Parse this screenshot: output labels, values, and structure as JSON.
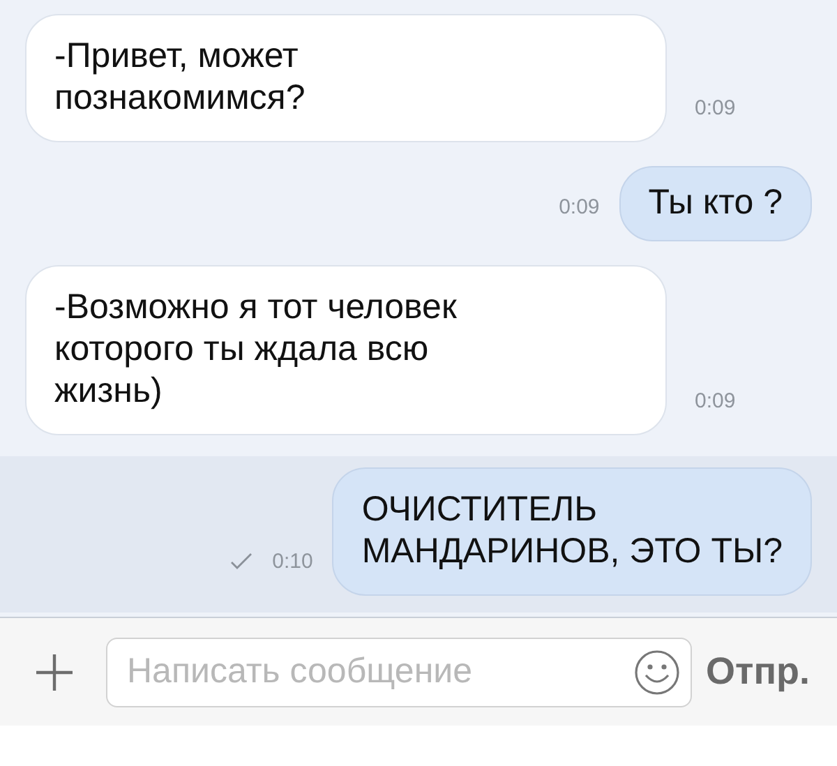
{
  "messages": [
    {
      "kind": "incoming",
      "text": "-Привет, может\nпознакомимся?",
      "time": "0:09",
      "selected": false
    },
    {
      "kind": "outgoing",
      "text": "Ты кто ?",
      "time": "0:09",
      "read": false,
      "selected": false
    },
    {
      "kind": "incoming",
      "text": "-Возможно я тот человек\nкоторого ты ждала всю\nжизнь)",
      "time": "0:09",
      "selected": false
    },
    {
      "kind": "outgoing",
      "text": "ОЧИСТИТЕЛЬ\nМАНДАРИНОВ, ЭТО ТЫ?",
      "time": "0:10",
      "read": true,
      "selected": true
    }
  ],
  "composer": {
    "placeholder": "Написать сообщение",
    "send": "Отпр."
  }
}
